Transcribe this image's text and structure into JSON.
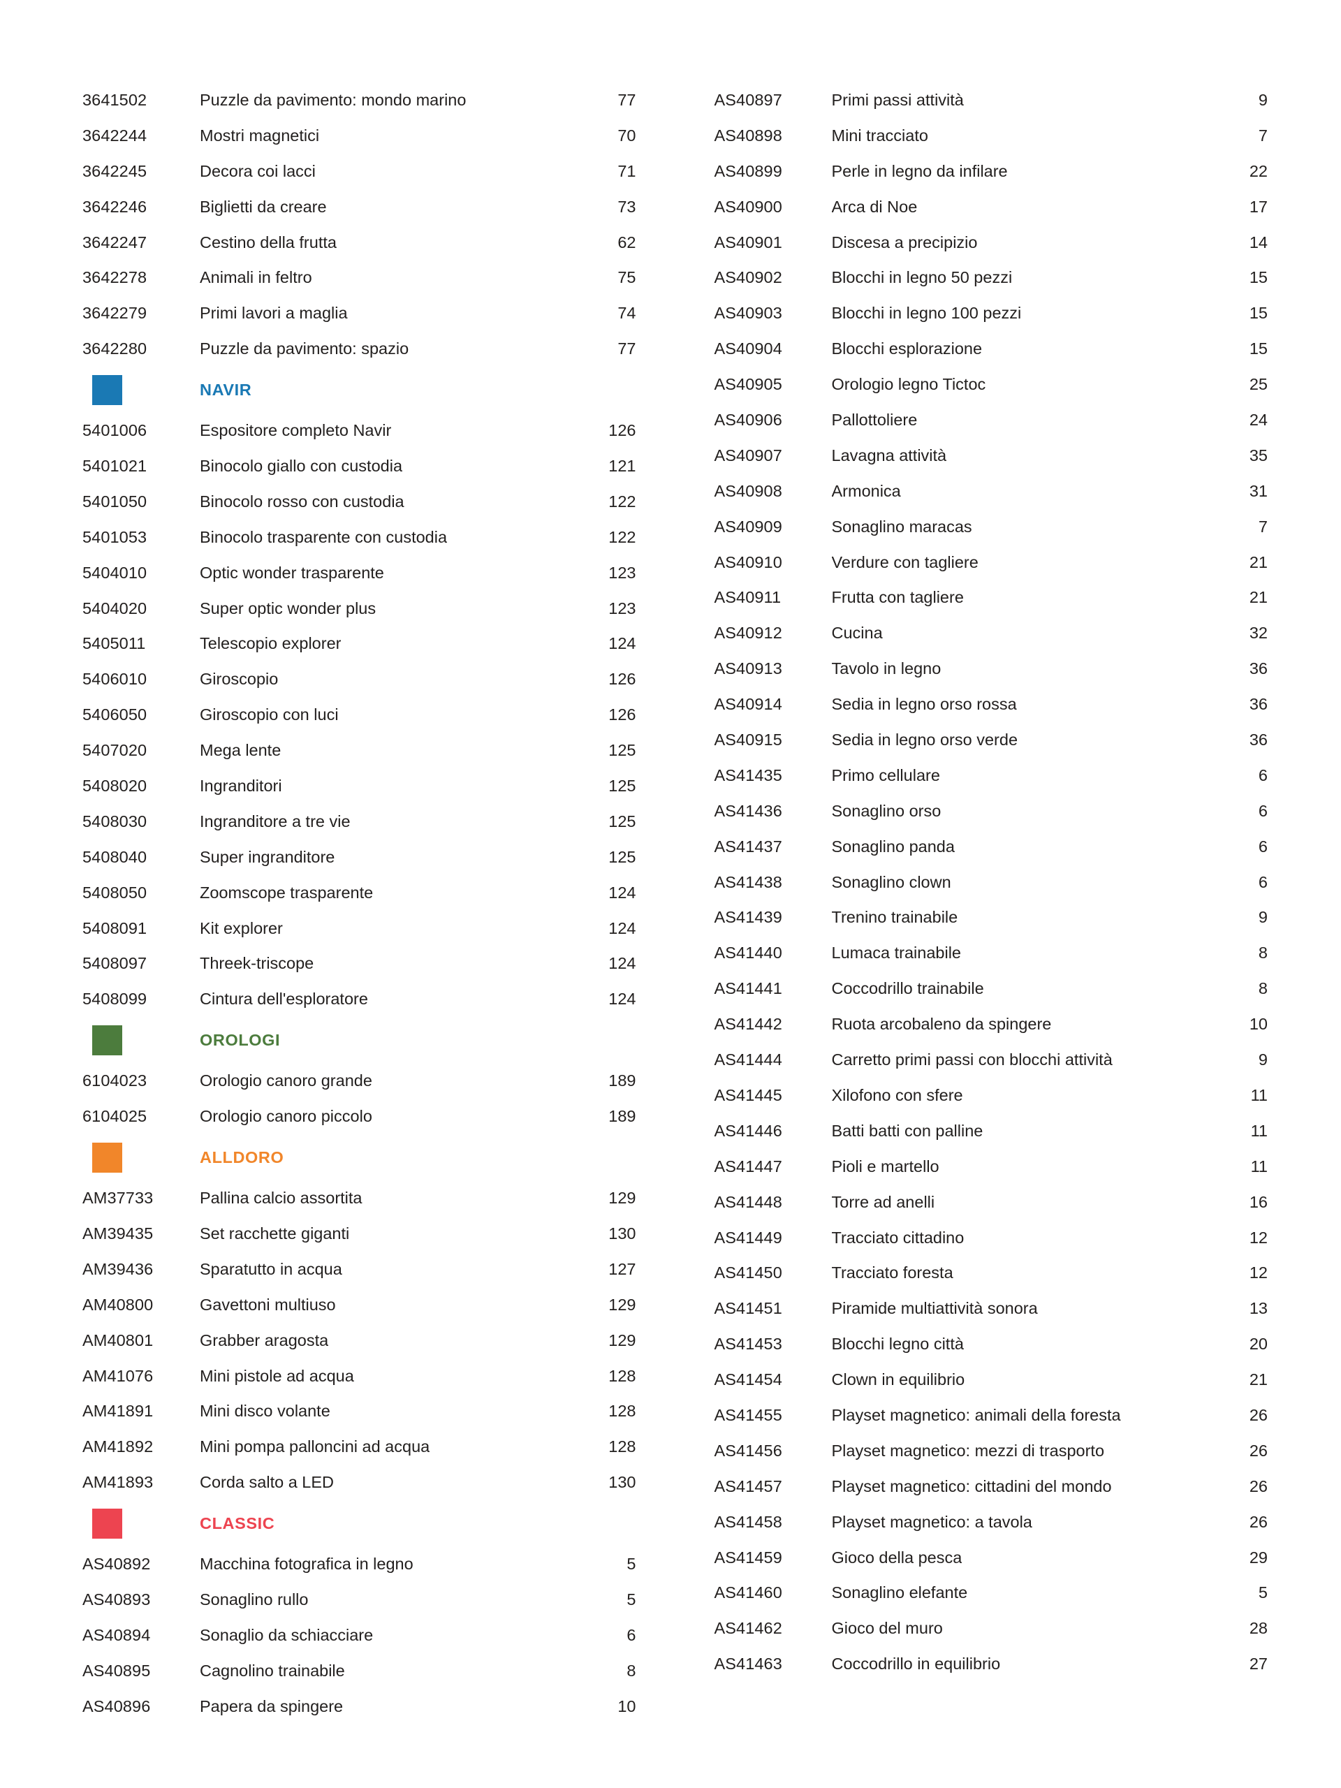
{
  "document": {
    "type": "catalog-index",
    "language": "it",
    "columns": 2,
    "colors": {
      "navir": "#1a79b4",
      "orologi": "#4c7c3d",
      "alldoro": "#f1862a",
      "classic": "#ed4450",
      "text": "#23201f",
      "background": "#ffffff"
    }
  },
  "left_column": [
    {
      "kind": "entry",
      "code": "3641502",
      "name": "Puzzle da pavimento: mondo marino",
      "page": "77"
    },
    {
      "kind": "entry",
      "code": "3642244",
      "name": "Mostri magnetici",
      "page": "70"
    },
    {
      "kind": "entry",
      "code": "3642245",
      "name": "Decora coi lacci ",
      "page": "71"
    },
    {
      "kind": "entry",
      "code": "3642246",
      "name": "Biglietti da creare",
      "page": "73"
    },
    {
      "kind": "entry",
      "code": "3642247",
      "name": "Cestino della frutta ",
      "page": "62"
    },
    {
      "kind": "entry",
      "code": "3642278",
      "name": "Animali in feltro",
      "page": "75"
    },
    {
      "kind": "entry",
      "code": "3642279",
      "name": "Primi lavori a maglia",
      "page": "74"
    },
    {
      "kind": "entry",
      "code": "3642280",
      "name": "Puzzle da pavimento: spazio",
      "page": "77"
    },
    {
      "kind": "section",
      "label": "NAVIR",
      "color": "#1a79b4"
    },
    {
      "kind": "entry",
      "code": "5401006",
      "name": "Espositore completo Navir",
      "page": "126"
    },
    {
      "kind": "entry",
      "code": "5401021",
      "name": "Binocolo giallo con custodia",
      "page": "121"
    },
    {
      "kind": "entry",
      "code": "5401050",
      "name": "Binocolo rosso con custodia ",
      "page": "122"
    },
    {
      "kind": "entry",
      "code": "5401053",
      "name": "Binocolo trasparente con custodia",
      "page": "122"
    },
    {
      "kind": "entry",
      "code": "5404010",
      "name": "Optic wonder trasparente",
      "page": "123"
    },
    {
      "kind": "entry",
      "code": "5404020",
      "name": "Super optic wonder plus",
      "page": "123"
    },
    {
      "kind": "entry",
      "code": "5405011",
      "name": "Telescopio explorer",
      "page": "124"
    },
    {
      "kind": "entry",
      "code": "5406010",
      "name": "Giroscopio",
      "page": "126"
    },
    {
      "kind": "entry",
      "code": "5406050",
      "name": "Giroscopio con luci",
      "page": "126"
    },
    {
      "kind": "entry",
      "code": "5407020",
      "name": "Mega lente",
      "page": "125"
    },
    {
      "kind": "entry",
      "code": "5408020",
      "name": "Ingranditori",
      "page": "125"
    },
    {
      "kind": "entry",
      "code": "5408030",
      "name": "Ingranditore a tre vie",
      "page": "125"
    },
    {
      "kind": "entry",
      "code": "5408040",
      "name": "Super ingranditore",
      "page": "125"
    },
    {
      "kind": "entry",
      "code": "5408050",
      "name": "Zoomscope trasparente",
      "page": "124"
    },
    {
      "kind": "entry",
      "code": "5408091",
      "name": "Kit explorer ",
      "page": "124"
    },
    {
      "kind": "entry",
      "code": "5408097",
      "name": "Threek-triscope ",
      "page": "124"
    },
    {
      "kind": "entry",
      "code": "5408099",
      "name": "Cintura dell'esploratore ",
      "page": "124"
    },
    {
      "kind": "section",
      "label": "OROLOGI",
      "color": "#4c7c3d"
    },
    {
      "kind": "entry",
      "code": "6104023",
      "name": "Orologio canoro grande",
      "page": "189"
    },
    {
      "kind": "entry",
      "code": "6104025",
      "name": "Orologio canoro piccolo ",
      "page": "189"
    },
    {
      "kind": "section",
      "label": "ALLDORO",
      "color": "#f1862a"
    },
    {
      "kind": "entry",
      "code": "AM37733",
      "name": "Pallina calcio assortita",
      "page": "129"
    },
    {
      "kind": "entry",
      "code": "AM39435",
      "name": "Set racchette giganti",
      "page": "130"
    },
    {
      "kind": "entry",
      "code": "AM39436",
      "name": "Sparatutto in acqua ",
      "page": "127"
    },
    {
      "kind": "entry",
      "code": "AM40800",
      "name": "Gavettoni multiuso",
      "page": "129"
    },
    {
      "kind": "entry",
      "code": "AM40801",
      "name": "Grabber aragosta",
      "page": "129"
    },
    {
      "kind": "entry",
      "code": "AM41076",
      "name": "Mini pistole ad acqua",
      "page": "128"
    },
    {
      "kind": "entry",
      "code": "AM41891",
      "name": "Mini disco volante",
      "page": "128"
    },
    {
      "kind": "entry",
      "code": "AM41892",
      "name": "Mini pompa palloncini ad acqua ",
      "page": "128"
    },
    {
      "kind": "entry",
      "code": "AM41893",
      "name": "Corda salto a LED",
      "page": "130"
    },
    {
      "kind": "section",
      "label": "CLASSIC",
      "color": "#ed4450"
    },
    {
      "kind": "entry",
      "code": "AS40892",
      "name": "Macchina fotografica in legno",
      "page": "5"
    },
    {
      "kind": "entry",
      "code": "AS40893",
      "name": "Sonaglino rullo",
      "page": "5"
    },
    {
      "kind": "entry",
      "code": "AS40894",
      "name": "Sonaglio da schiacciare ",
      "page": "6"
    },
    {
      "kind": "entry",
      "code": "AS40895",
      "name": "Cagnolino trainabile",
      "page": "8"
    },
    {
      "kind": "entry",
      "code": "AS40896",
      "name": "Papera da spingere",
      "page": "10"
    }
  ],
  "right_column": [
    {
      "kind": "entry",
      "code": "AS40897",
      "name": "Primi passi attività",
      "page": "9"
    },
    {
      "kind": "entry",
      "code": "AS40898",
      "name": "Mini tracciato",
      "page": "7"
    },
    {
      "kind": "entry",
      "code": "AS40899",
      "name": "Perle in legno da infilare",
      "page": "22"
    },
    {
      "kind": "entry",
      "code": "AS40900",
      "name": "Arca di Noe",
      "page": "17"
    },
    {
      "kind": "entry",
      "code": "AS40901",
      "name": "Discesa a precipizio",
      "page": "14"
    },
    {
      "kind": "entry",
      "code": "AS40902",
      "name": "Blocchi in legno 50 pezzi",
      "page": "15"
    },
    {
      "kind": "entry",
      "code": "AS40903",
      "name": "Blocchi in legno 100 pezzi",
      "page": "15"
    },
    {
      "kind": "entry",
      "code": "AS40904",
      "name": "Blocchi esplorazione",
      "page": "15"
    },
    {
      "kind": "entry",
      "code": "AS40905",
      "name": "Orologio legno Tictoc",
      "page": "25"
    },
    {
      "kind": "entry",
      "code": "AS40906",
      "name": "Pallottoliere",
      "page": "24"
    },
    {
      "kind": "entry",
      "code": "AS40907",
      "name": "Lavagna attività",
      "page": "35"
    },
    {
      "kind": "entry",
      "code": "AS40908",
      "name": "Armonica",
      "page": "31"
    },
    {
      "kind": "entry",
      "code": "AS40909",
      "name": "Sonaglino maracas",
      "page": "7"
    },
    {
      "kind": "entry",
      "code": "AS40910",
      "name": "Verdure con tagliere",
      "page": "21"
    },
    {
      "kind": "entry",
      "code": "AS40911",
      "name": "Frutta con tagliere",
      "page": "21"
    },
    {
      "kind": "entry",
      "code": "AS40912",
      "name": "Cucina",
      "page": "32"
    },
    {
      "kind": "entry",
      "code": "AS40913",
      "name": "Tavolo in legno",
      "page": "36"
    },
    {
      "kind": "entry",
      "code": "AS40914",
      "name": "Sedia in legno orso rossa ",
      "page": "36"
    },
    {
      "kind": "entry",
      "code": "AS40915",
      "name": "Sedia in legno orso verde",
      "page": "36"
    },
    {
      "kind": "entry",
      "code": "AS41435",
      "name": "Primo cellulare",
      "page": "6"
    },
    {
      "kind": "entry",
      "code": "AS41436",
      "name": "Sonaglino orso ",
      "page": "6"
    },
    {
      "kind": "entry",
      "code": "AS41437",
      "name": "Sonaglino panda",
      "page": "6"
    },
    {
      "kind": "entry",
      "code": "AS41438",
      "name": "Sonaglino clown ",
      "page": "6"
    },
    {
      "kind": "entry",
      "code": "AS41439",
      "name": "Trenino trainabile",
      "page": "9"
    },
    {
      "kind": "entry",
      "code": "AS41440",
      "name": "Lumaca trainabile ",
      "page": "8"
    },
    {
      "kind": "entry",
      "code": "AS41441",
      "name": "Coccodrillo trainabile",
      "page": "8"
    },
    {
      "kind": "entry",
      "code": "AS41442",
      "name": "Ruota arcobaleno da spingere",
      "page": "10"
    },
    {
      "kind": "entry",
      "code": "AS41444",
      "name": "Carretto primi passi con blocchi attività",
      "page": "9"
    },
    {
      "kind": "entry",
      "code": "AS41445",
      "name": "Xilofono con sfere",
      "page": "11"
    },
    {
      "kind": "entry",
      "code": "AS41446",
      "name": "Batti batti con palline ",
      "page": "11"
    },
    {
      "kind": "entry",
      "code": "AS41447",
      "name": "Pioli e martello",
      "page": "11"
    },
    {
      "kind": "entry",
      "code": "AS41448",
      "name": "Torre ad anelli ",
      "page": "16"
    },
    {
      "kind": "entry",
      "code": "AS41449",
      "name": "Tracciato cittadino",
      "page": "12"
    },
    {
      "kind": "entry",
      "code": "AS41450",
      "name": "Tracciato foresta ",
      "page": "12"
    },
    {
      "kind": "entry",
      "code": "AS41451",
      "name": "Piramide multiattività sonora",
      "page": "13"
    },
    {
      "kind": "entry",
      "code": "AS41453",
      "name": "Blocchi legno città",
      "page": "20"
    },
    {
      "kind": "entry",
      "code": "AS41454",
      "name": "Clown in equilibrio",
      "page": "21"
    },
    {
      "kind": "entry",
      "code": "AS41455",
      "name": "Playset magnetico: animali della foresta",
      "page": "26"
    },
    {
      "kind": "entry",
      "code": "AS41456",
      "name": "Playset magnetico: mezzi di trasporto ",
      "page": "26"
    },
    {
      "kind": "entry",
      "code": "AS41457",
      "name": "Playset magnetico: cittadini del mondo",
      "page": "26"
    },
    {
      "kind": "entry",
      "code": "AS41458",
      "name": "Playset magnetico: a tavola",
      "page": "26"
    },
    {
      "kind": "entry",
      "code": "AS41459",
      "name": "Gioco della pesca ",
      "page": "29"
    },
    {
      "kind": "entry",
      "code": "AS41460",
      "name": "Sonaglino elefante ",
      "page": "5"
    },
    {
      "kind": "entry",
      "code": "AS41462",
      "name": "Gioco del muro",
      "page": "28"
    },
    {
      "kind": "entry",
      "code": "AS41463",
      "name": "Coccodrillo in equilibrio",
      "page": "27"
    }
  ]
}
